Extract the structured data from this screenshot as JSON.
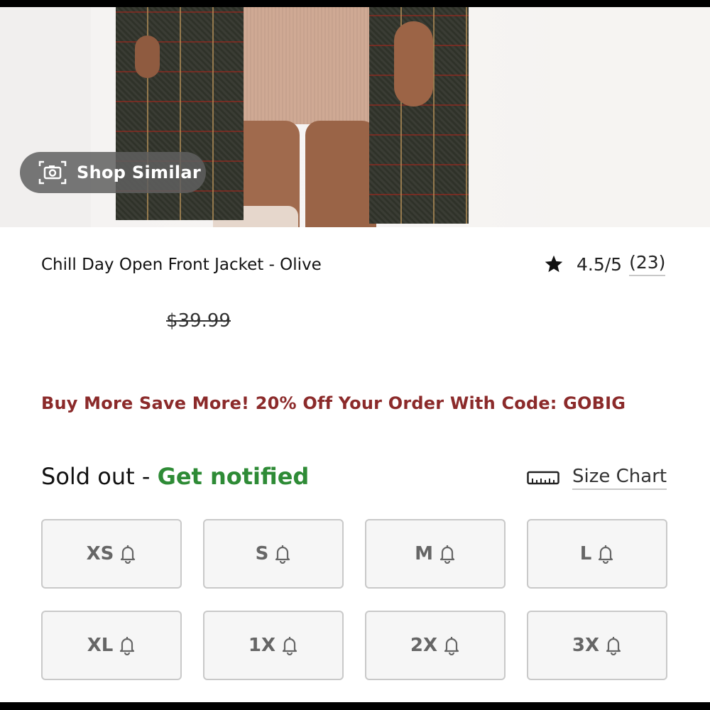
{
  "product": {
    "image_action_label": "Shop Similar",
    "title": "Chill Day Open Front Jacket - Olive",
    "rating": {
      "score": "4.5/5",
      "count": "(23)"
    },
    "price": "$39.99"
  },
  "promo": "Buy More Save More! 20% Off Your Order With Code: GOBIG",
  "availability": {
    "status": "Sold out",
    "separator": " - ",
    "notify_label": "Get notified"
  },
  "size_chart_label": "Size Chart",
  "sizes": [
    {
      "label": "XS"
    },
    {
      "label": "S"
    },
    {
      "label": "M"
    },
    {
      "label": "L"
    },
    {
      "label": "XL"
    },
    {
      "label": "1X"
    },
    {
      "label": "2X"
    },
    {
      "label": "3X"
    }
  ],
  "colors": {
    "promo": "#8b2a2a",
    "notify": "#2e8b36",
    "pill_bg": "#5f5f5f"
  }
}
